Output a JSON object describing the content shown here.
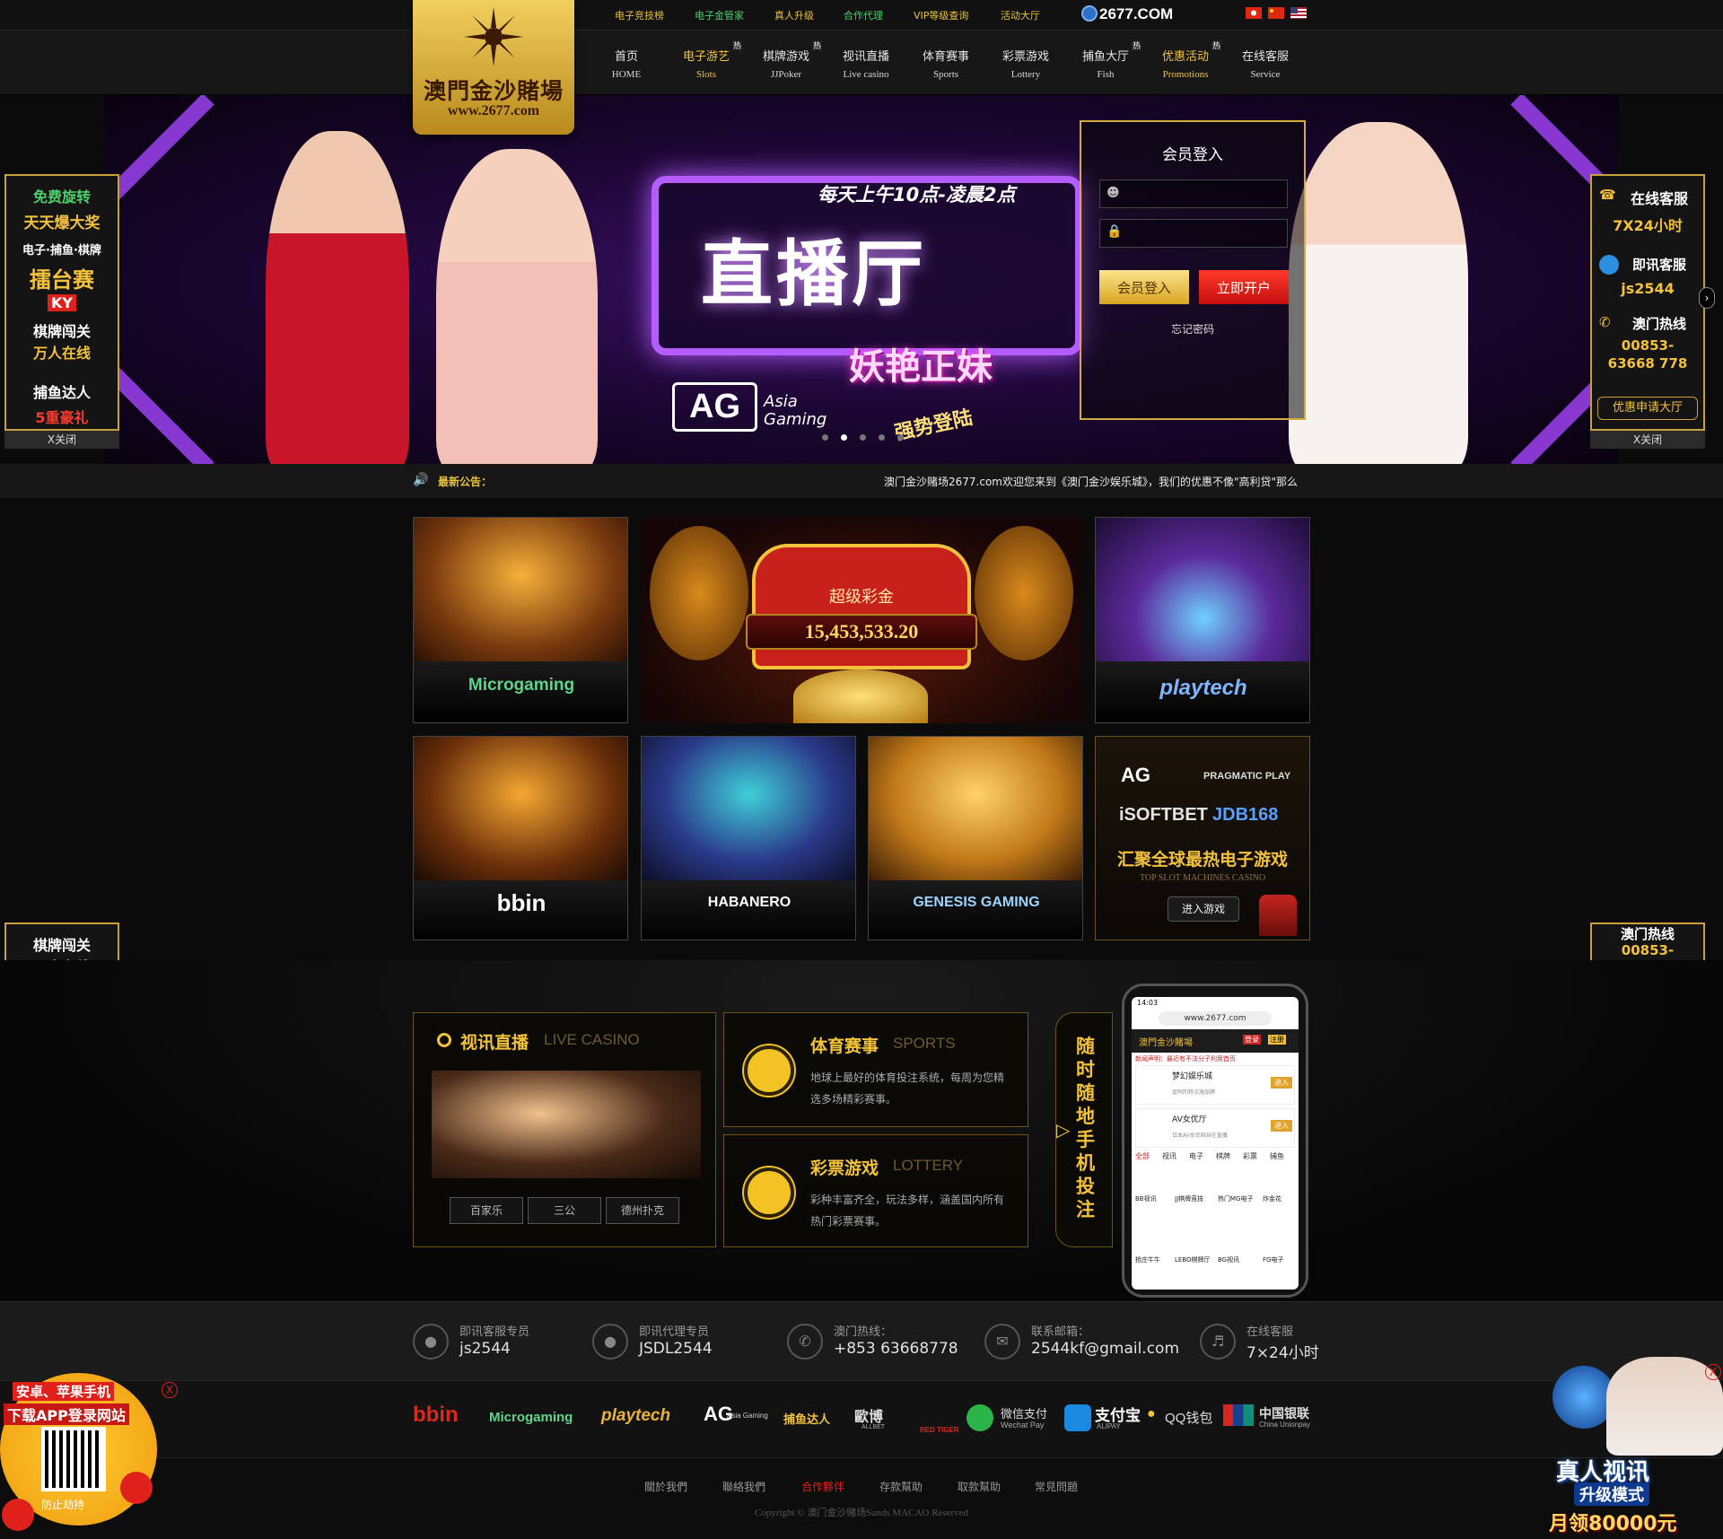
{
  "topbar": {
    "links": [
      "电子竞技榜",
      "电子金管家",
      "真人升级",
      "合作代理",
      "VIP等级查询",
      "活动大厅"
    ],
    "domain": "2677.COM"
  },
  "logo": {
    "title": "澳門金沙賭場",
    "url": "www.2677.com"
  },
  "nav": [
    {
      "zh": "首页",
      "en": "HOME",
      "hot": false
    },
    {
      "zh": "电子游艺",
      "en": "Slots",
      "hot": true
    },
    {
      "zh": "棋牌游戏",
      "en": "JJPoker",
      "hot": true
    },
    {
      "zh": "视讯直播",
      "en": "Live casino",
      "hot": false
    },
    {
      "zh": "体育赛事",
      "en": "Sports",
      "hot": false
    },
    {
      "zh": "彩票游戏",
      "en": "Lottery",
      "hot": false
    },
    {
      "zh": "捕鱼大厅",
      "en": "Fish",
      "hot": true
    },
    {
      "zh": "优惠活动",
      "en": "Promotions",
      "hot": true
    },
    {
      "zh": "在线客服",
      "en": "Service",
      "hot": false
    }
  ],
  "hot_badge": "热",
  "banner": {
    "subtitle": "每天上午10点-凌晨2点",
    "title": "直播厅",
    "tag": "妖艳正妹",
    "brand_short": "AG",
    "brand": "Asia Gaming",
    "slogan": "强势登陆"
  },
  "login": {
    "title": "会员登入",
    "login_btn": "会员登入",
    "register_btn": "立即开户",
    "forgot": "忘记密码"
  },
  "notice": {
    "label": "最新公告：",
    "text": "澳门金沙赌场2677.com欢迎您来到《澳门金沙娱乐城》，我们的优惠不像\"高利贷\"那么"
  },
  "left_float": {
    "l1": "免费旋转",
    "l2": "天天爆大奖",
    "l3": "电子·捕鱼·棋牌",
    "l4": "擂台赛",
    "l5": "KY",
    "l6": "棋牌闯关",
    "l7": "万人在线",
    "l8": "捕鱼达人",
    "l9": "5重豪礼",
    "close": "X关闭"
  },
  "right_float": {
    "l1": "在线客服",
    "l2": "7X24小时",
    "l3": "即讯客服",
    "l4": "js2544",
    "l5": "澳门热线",
    "l6": "00853-",
    "l7": "63668 778",
    "l8": "优惠申请大厅",
    "close": "X关闭"
  },
  "tiles": {
    "microgaming": "Microgaming",
    "playtech": "playtech",
    "bbin": "bbin",
    "habanero": "HABANERO",
    "genesis": "GENESIS GAMING"
  },
  "jackpot": {
    "label": "超级彩金",
    "value": "15,453,533.20"
  },
  "allslots": {
    "providers": [
      "AG",
      "PRAGMATIC PLAY",
      "iSOFTBET",
      "JDB168"
    ],
    "title": "汇聚全球最热电子游戏",
    "subtitle": "TOP SLOT MACHINES CASINO",
    "enter": "进入游戏"
  },
  "live_panel": {
    "title": "视讯直播",
    "en": "LIVE CASINO",
    "games": [
      "百家乐",
      "三公",
      "德州扑克"
    ]
  },
  "sports_panel": {
    "title": "体育赛事",
    "en": "SPORTS",
    "desc": "地球上最好的体育投注系统，每周为您精选多场精彩赛事。"
  },
  "lottery_panel": {
    "title": "彩票游戏",
    "en": "LOTTERY",
    "desc": "彩种丰富齐全，玩法多样，涵盖国内所有热门彩票赛事。"
  },
  "mobile_tag": "随时随地 手机投注",
  "phone": {
    "time": "14:03",
    "url": "www.2677.com",
    "site": "澳門金沙賭場",
    "login": "登录",
    "register": "注册",
    "ticker": "新闻声明：最近有不法分子利用首页",
    "cards": [
      {
        "name": "梦幻娱乐城",
        "desc": "金阿的特点施品牌",
        "btn": "进入"
      },
      {
        "name": "AV女优厅",
        "desc": "日本AV女优陪玩在直播",
        "btn": "进入"
      }
    ],
    "tabs": [
      "全部",
      "视讯",
      "电子",
      "棋牌",
      "彩票",
      "捕鱼"
    ],
    "games": [
      "BB视讯",
      "JJ棋牌竞技",
      "热门MG电子",
      "炸金花",
      "抢庄牛牛",
      "LEBO棋牌厅",
      "BG视讯",
      "FG电子"
    ]
  },
  "footer_contacts": [
    {
      "label": "即讯客服专员",
      "value": "js2544",
      "icon": "chat-icon"
    },
    {
      "label": "即讯代理专员",
      "value": "JSDL2544",
      "icon": "chat-icon"
    },
    {
      "label": "澳门热线：",
      "value": "+853 63668778",
      "icon": "phone-icon"
    },
    {
      "label": "联系邮箱：",
      "value": "2544kf@gmail.com",
      "icon": "mail-icon"
    },
    {
      "label": "在线客服",
      "value": "7×24小时",
      "icon": "headset-icon"
    }
  ],
  "payments": [
    "bbin",
    "Microgaming",
    "playtech",
    "AG",
    "捕鱼达人",
    "歐博",
    "RED TIGER",
    "微信支付",
    "支付宝",
    "QQ钱包",
    "中国银联"
  ],
  "payment_subs": {
    "wechat": "Wechat Pay",
    "alipay": "ALIPAY",
    "unionpay": "China Unionpay",
    "allbet": "ALLBET",
    "ag": "Asia Gaming"
  },
  "footer_links": [
    "關於我們",
    "聯絡我們",
    "合作夥伴",
    "存款幫助",
    "取款幫助",
    "常見問題"
  ],
  "copyright": "Copyright © 澳门金沙赌场Sands MACAO Reserved",
  "app_ad": {
    "l1": "安卓、苹果手机",
    "l2": "下载APP登录网站",
    "l3": "防止劫持",
    "close": "X"
  },
  "live_ad": {
    "l1": "真人视讯",
    "l2": "升级模式",
    "l3": "月领80000元",
    "close": "X"
  },
  "colors": {
    "gold": "#e8c23a",
    "green": "#46d36a",
    "red": "#e0201a",
    "bg": "#0b0b0b"
  }
}
